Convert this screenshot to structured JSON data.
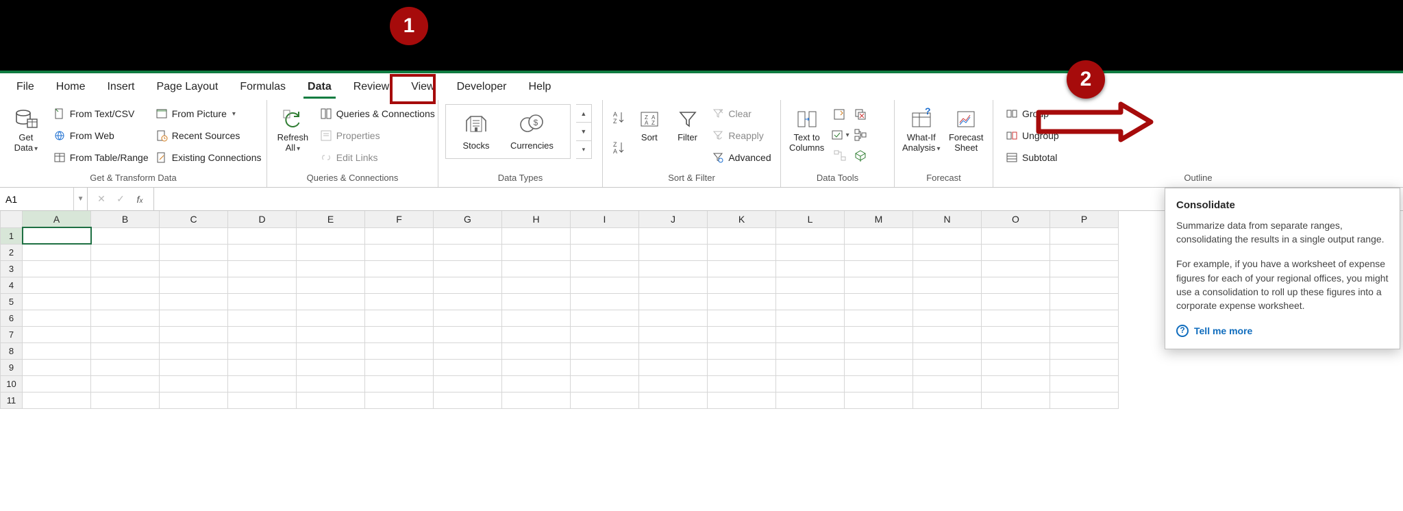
{
  "tabs": {
    "file": "File",
    "home": "Home",
    "insert": "Insert",
    "page_layout": "Page Layout",
    "formulas": "Formulas",
    "data": "Data",
    "review": "Review",
    "view": "View",
    "developer": "Developer",
    "help": "Help"
  },
  "groups": {
    "get_transform": "Get & Transform Data",
    "queries": "Queries & Connections",
    "data_types": "Data Types",
    "sort_filter": "Sort & Filter",
    "data_tools": "Data Tools",
    "forecast": "Forecast",
    "outline": "Outline"
  },
  "get_data": {
    "label_line1": "Get",
    "label_line2": "Data"
  },
  "gt": {
    "text_csv": "From Text/CSV",
    "picture": "From Picture",
    "web": "From Web",
    "recent": "Recent Sources",
    "table": "From Table/Range",
    "existing": "Existing Connections"
  },
  "refresh": {
    "line1": "Refresh",
    "line2": "All"
  },
  "qc": {
    "queries": "Queries & Connections",
    "properties": "Properties",
    "edit_links": "Edit Links"
  },
  "dt": {
    "stocks": "Stocks",
    "currencies": "Currencies"
  },
  "sort": {
    "sort": "Sort",
    "filter": "Filter",
    "clear": "Clear",
    "reapply": "Reapply",
    "advanced": "Advanced"
  },
  "tools": {
    "ttc_line1": "Text to",
    "ttc_line2": "Columns",
    "flash": "Flash Fill",
    "dup": "Remove Duplicates",
    "validation": "Data Validation",
    "consolidate": "Consolidate",
    "relationships": "Relationships",
    "model": "Data Model"
  },
  "forecast": {
    "what_if_line1": "What-If",
    "what_if_line2": "Analysis",
    "sheet_line1": "Forecast",
    "sheet_line2": "Sheet"
  },
  "outline": {
    "group": "Group",
    "ungroup": "Ungroup",
    "subtotal": "Subtotal"
  },
  "namebox": "A1",
  "columns": [
    "A",
    "B",
    "C",
    "D",
    "E",
    "F",
    "G",
    "H",
    "I",
    "J",
    "K",
    "L",
    "M",
    "N",
    "O",
    "P"
  ],
  "rows": [
    "1",
    "2",
    "3",
    "4",
    "5",
    "6",
    "7",
    "8",
    "9",
    "10",
    "11"
  ],
  "callouts": {
    "one": "1",
    "two": "2"
  },
  "tooltip": {
    "title": "Consolidate",
    "p1": "Summarize data from separate ranges, consolidating the results in a single output range.",
    "p2": "For example, if you have a worksheet of expense figures for each of your regional offices, you might use a consolidation to roll up these figures into a corporate expense worksheet.",
    "more": "Tell me more"
  }
}
